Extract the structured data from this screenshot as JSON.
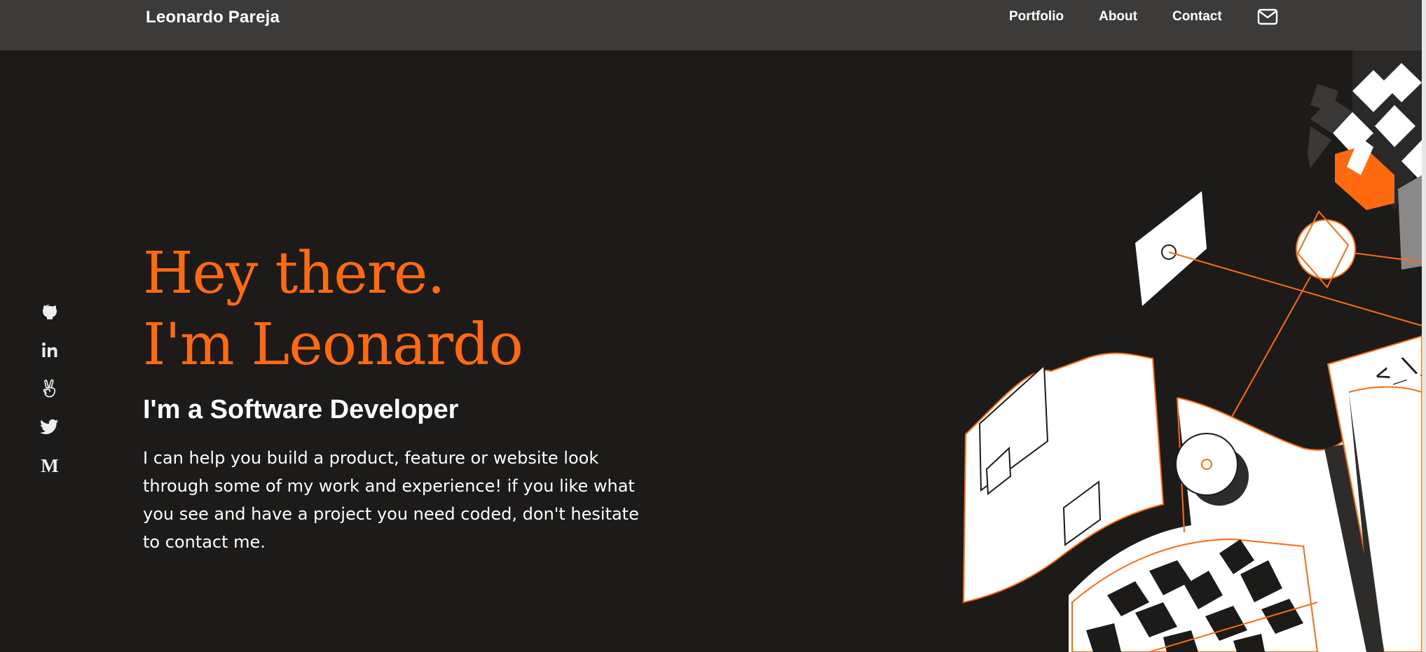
{
  "navbar": {
    "brand": "Leonardo Pareja",
    "links": [
      {
        "label": "Portfolio"
      },
      {
        "label": "About"
      },
      {
        "label": "Contact"
      }
    ],
    "mail_icon": "mail-icon"
  },
  "social": {
    "items": [
      {
        "icon": "github-icon"
      },
      {
        "icon": "linkedin-icon"
      },
      {
        "icon": "angellist-icon"
      },
      {
        "icon": "twitter-icon"
      },
      {
        "icon": "medium-icon",
        "glyph": "M"
      }
    ]
  },
  "hero": {
    "title_line1": "Hey there.",
    "title_line2": "I'm Leonardo",
    "subtitle": "I'm a Software Developer",
    "body": "I can help you build a product, feature or website look through some of my work and experience! if you like what you see and have a project you need coded, don't hesitate to contact me."
  },
  "illustration": {
    "code_label": "<_\\_"
  },
  "colors": {
    "accent": "#ff6a10",
    "background": "#1c1b1a",
    "navbar": "#3c3b3a",
    "text": "#ffffff"
  }
}
